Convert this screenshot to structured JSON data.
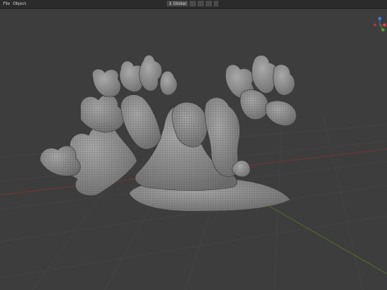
{
  "header": {
    "menus": [
      "File",
      "Object"
    ],
    "transform_orientation": "Global",
    "icons": [
      "mesh-icon",
      "transform-orientation-icon",
      "pivot-icon",
      "snap-icon",
      "proportional-edit-icon",
      "view-icon",
      "overlay-icon",
      "wireframe-shading-icon"
    ]
  },
  "viewport": {
    "background": "#3d3d3d",
    "grid_color": "#4a4a4a",
    "x_axis_color": "#8b3a3a",
    "y_axis_color": "#5c7a33",
    "model_fill": "#8c8c8c",
    "wire_color": "#2a2a2a"
  },
  "gizmo": {
    "x_color": "#e04050",
    "y_color": "#5a9a2a",
    "z_color": "#3a7ae0"
  }
}
